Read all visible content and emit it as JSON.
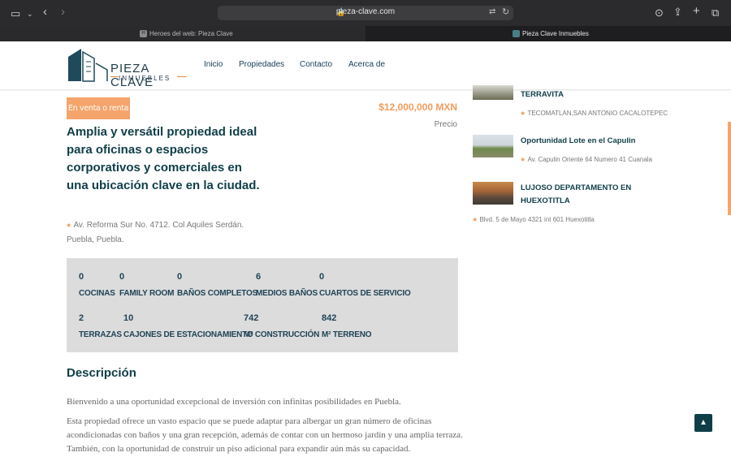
{
  "browser": {
    "url": "pieza-clave.com",
    "tabs": [
      {
        "label": "Heroes del web: Pieza Clave",
        "favicon": "H"
      },
      {
        "label": "Pieza Clave Inmuebles"
      }
    ]
  },
  "header": {
    "logo_title": "PIEZA CLAVE",
    "logo_sub": "INMUEBLES",
    "nav": [
      "Inicio",
      "Propiedades",
      "Contacto",
      "Acerca de"
    ]
  },
  "property": {
    "badge": "En venta o renta",
    "price": "$12,000,000 MXN",
    "price_label": "Precio",
    "title": "Amplia y versátil propiedad ideal para oficinas o espacios corporativos y comerciales en una ubicación clave en la ciudad.",
    "address": "Av. Reforma Sur No. 4712. Col Aquiles Serdán. Puebla, Puebla.",
    "features": [
      {
        "value": "0",
        "label": "COCINAS"
      },
      {
        "value": "0",
        "label": "FAMILY ROOM"
      },
      {
        "value": "0",
        "label": "BAÑOS COMPLETOS"
      },
      {
        "value": "6",
        "label": "MEDIOS BAÑOS"
      },
      {
        "value": "0",
        "label": "CUARTOS DE SERVICIO"
      },
      {
        "value": "2",
        "label": "TERRAZAS"
      },
      {
        "value": "10",
        "label": "CAJONES DE ESTACIONAMIENTO"
      },
      {
        "value": "742",
        "label": "M² CONSTRUCCIÓN"
      },
      {
        "value": "842",
        "label": "M² TERRENO"
      }
    ],
    "description_title": "Descripción",
    "description": [
      "Bienvenido a una oportunidad excepcional de inversión con infinitas posibilidades en Puebla.",
      "Esta propiedad ofrece un vasto espacio que se puede adaptar para albergar un gran número de oficinas acondicionadas con baños y una gran recepción, además de contar con un hermoso jardín y una amplia terraza. También, con la oportunidad de construir un piso adicional para expandir aún más su capacidad."
    ]
  },
  "sidebar": [
    {
      "title": "TERRAVITA",
      "address": "TECOMATLAN,SAN ANTONIO CACALOTEPEC"
    },
    {
      "title": "Oportunidad Lote en el Capulin",
      "address": "Av. Capulin Oriente 64 Numero 41 Cuanala"
    },
    {
      "title": "LUJOSO DEPARTAMENTO EN HUEXOTITLA",
      "address": "Blvd. 5 de Mayo 4321 int 601 Huexotitla"
    }
  ],
  "colors": {
    "accent": "#f5a46b",
    "brand": "#0f3e48",
    "price": "#f39c5b"
  },
  "icons": {
    "back_to_top": "chevron-up-icon",
    "location": "map-pin-icon"
  }
}
